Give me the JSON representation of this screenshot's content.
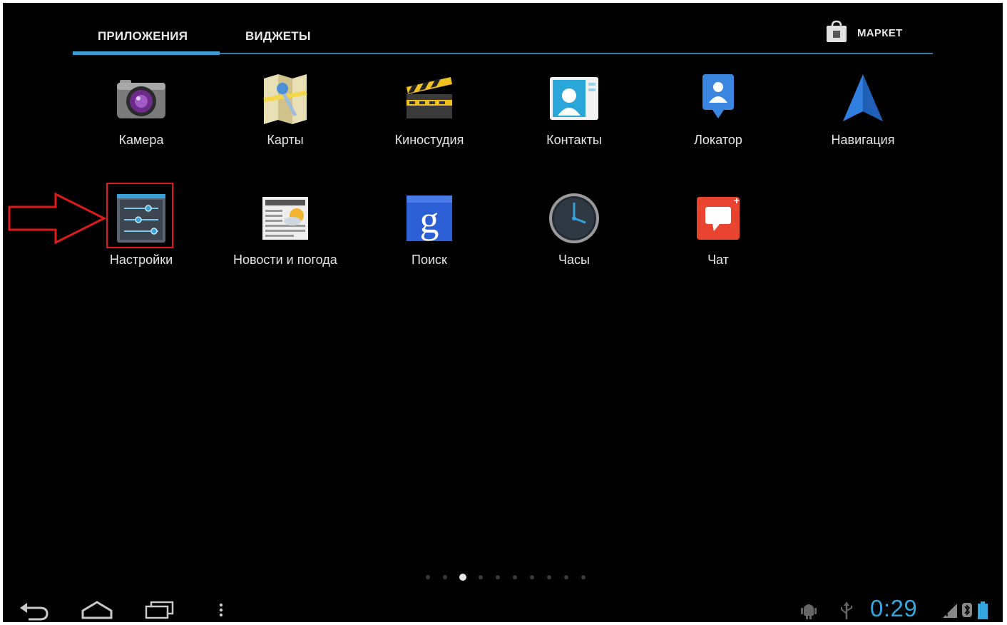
{
  "tabs": {
    "apps": "ПРИЛОЖЕНИЯ",
    "widgets": "ВИДЖЕТЫ",
    "market": "МАРКЕТ"
  },
  "apps": [
    {
      "label": "Камера",
      "icon": "camera-icon"
    },
    {
      "label": "Карты",
      "icon": "maps-icon"
    },
    {
      "label": "Киностудия",
      "icon": "movie-studio-icon"
    },
    {
      "label": "Контакты",
      "icon": "contacts-icon"
    },
    {
      "label": "Локатор",
      "icon": "latitude-icon"
    },
    {
      "label": "Навигация",
      "icon": "navigation-icon"
    },
    {
      "label": "Настройки",
      "icon": "settings-icon"
    },
    {
      "label": "Новости и погода",
      "icon": "news-weather-icon"
    },
    {
      "label": "Поиск",
      "icon": "google-search-icon"
    },
    {
      "label": "Часы",
      "icon": "clock-icon"
    },
    {
      "label": "Чат",
      "icon": "talk-icon"
    }
  ],
  "pager": {
    "pages": 10,
    "current": 3
  },
  "status": {
    "time": "0:29"
  },
  "colors": {
    "accent": "#33a8e0",
    "highlight": "#e01a1a"
  }
}
